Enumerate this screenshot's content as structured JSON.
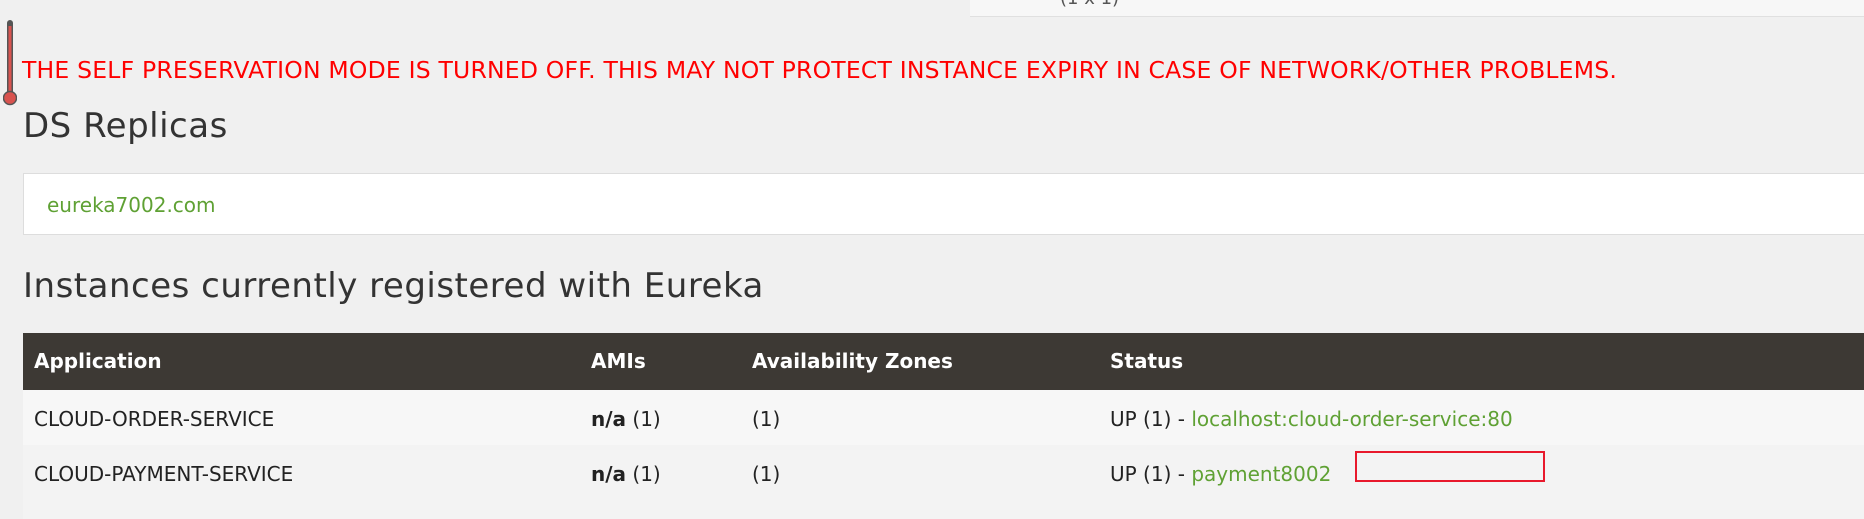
{
  "top_panel": {
    "text": "(1 x 1)"
  },
  "warning": {
    "text": "THE SELF PRESERVATION MODE IS TURNED OFF. THIS MAY NOT PROTECT INSTANCE EXPIRY IN CASE OF NETWORK/OTHER PROBLEMS.",
    "color": "#ff0000"
  },
  "replicas": {
    "title": "DS Replicas",
    "items": [
      {
        "label": "eureka7002.com"
      }
    ]
  },
  "instances": {
    "title": "Instances currently registered with Eureka",
    "headers": [
      "Application",
      "AMIs",
      "Availability Zones",
      "Status"
    ],
    "rows": [
      {
        "application": "CLOUD-ORDER-SERVICE",
        "ami_label": "n/a",
        "ami_count": "(1)",
        "zones": "(1)",
        "status_prefix": "UP (1) -",
        "instance_link": "localhost:cloud-order-service:80"
      },
      {
        "application": "CLOUD-PAYMENT-SERVICE",
        "ami_label": "n/a",
        "ami_count": "(1)",
        "zones": "(1)",
        "status_prefix": "UP (1) -",
        "instance_link": "payment8002"
      }
    ]
  },
  "colors": {
    "header_bg": "#3d3934",
    "link": "#5fa134",
    "highlight_box": "#e8192c"
  },
  "icons": {
    "thermometer": "thermometer-icon"
  }
}
